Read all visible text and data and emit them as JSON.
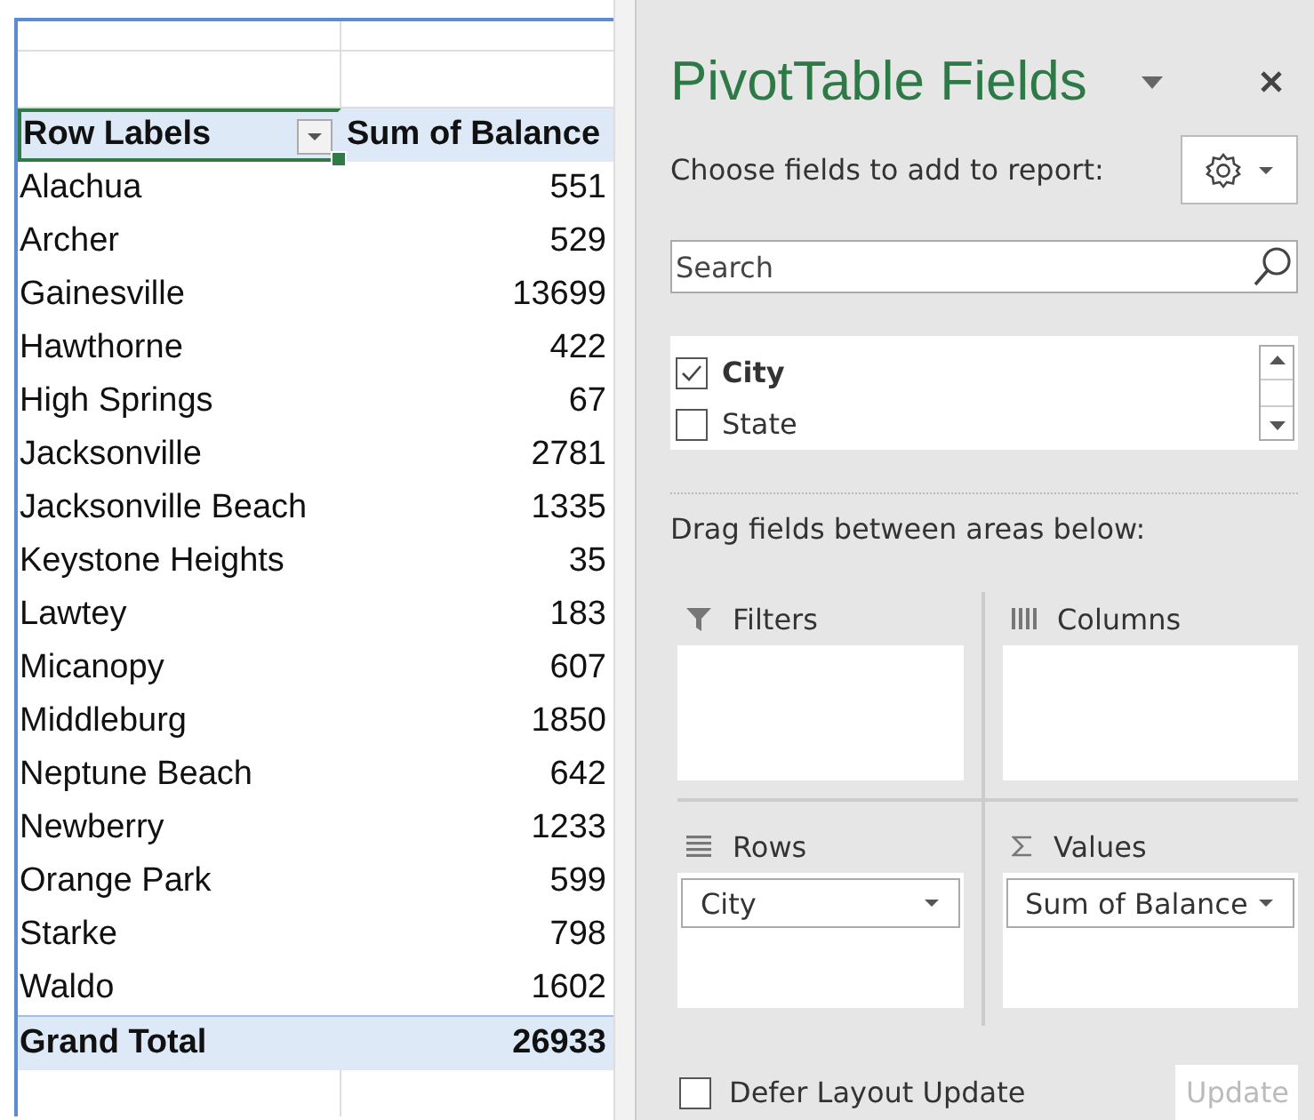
{
  "pivot_table": {
    "header": {
      "row_labels": "Row Labels",
      "value_column": "Sum of Balance"
    },
    "rows": [
      {
        "label": "Alachua",
        "value": "551"
      },
      {
        "label": "Archer",
        "value": "529"
      },
      {
        "label": "Gainesville",
        "value": "13699"
      },
      {
        "label": "Hawthorne",
        "value": "422"
      },
      {
        "label": "High Springs",
        "value": "67"
      },
      {
        "label": "Jacksonville",
        "value": "2781"
      },
      {
        "label": "Jacksonville Beach",
        "value": "1335"
      },
      {
        "label": "Keystone Heights",
        "value": "35"
      },
      {
        "label": "Lawtey",
        "value": "183"
      },
      {
        "label": "Micanopy",
        "value": "607"
      },
      {
        "label": "Middleburg",
        "value": "1850"
      },
      {
        "label": "Neptune Beach",
        "value": "642"
      },
      {
        "label": "Newberry",
        "value": "1233"
      },
      {
        "label": "Orange Park",
        "value": "599"
      },
      {
        "label": "Starke",
        "value": "798"
      },
      {
        "label": "Waldo",
        "value": "1602"
      }
    ],
    "grand_total": {
      "label": "Grand Total",
      "value": "26933"
    }
  },
  "panel": {
    "title": "PivotTable Fields",
    "prompt": "Choose fields to add to report:",
    "search": {
      "placeholder": "Search"
    },
    "fields": [
      {
        "name": "City",
        "checked": true
      },
      {
        "name": "State",
        "checked": false
      }
    ],
    "drag_label": "Drag fields between areas below:",
    "areas": [
      {
        "kind": "filters",
        "label": "Filters"
      },
      {
        "kind": "columns",
        "label": "Columns"
      },
      {
        "kind": "rows",
        "label": "Rows",
        "items": [
          "City"
        ]
      },
      {
        "kind": "values",
        "label": "Values",
        "items": [
          "Sum of Balance"
        ]
      }
    ],
    "defer": {
      "label": "Defer Layout Update",
      "checked": false
    },
    "update_button": {
      "label": "Update",
      "disabled": true
    }
  }
}
